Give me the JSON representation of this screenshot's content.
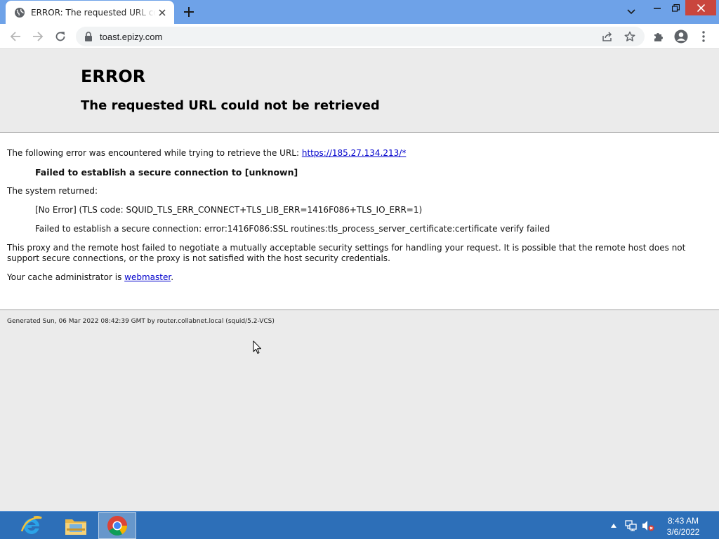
{
  "browser": {
    "tab": {
      "title": "ERROR: The requested URL could not be retrieved",
      "icon": "globe-icon"
    },
    "new_tab_symbol": "+",
    "address": {
      "url": "toast.epizy.com",
      "icon": "lock-icon"
    }
  },
  "page": {
    "heading": "ERROR",
    "subheading": "The requested URL could not be retrieved",
    "intro_text": "The following error was encountered while trying to retrieve the URL: ",
    "intro_link": "https://185.27.134.213/*",
    "error_title": "Failed to establish a secure connection to [unknown]",
    "system_returned": "The system returned:",
    "detail_line_1": "[No Error] (TLS code: SQUID_TLS_ERR_CONNECT+TLS_LIB_ERR=1416F086+TLS_IO_ERR=1)",
    "detail_line_2": "Failed to establish a secure connection: error:1416F086:SSL routines:tls_process_server_certificate:certificate verify failed",
    "explanation": "This proxy and the remote host failed to negotiate a mutually acceptable security settings for handling your request. It is possible that the remote host does not support secure connections, or the proxy is not satisfied with the host security credentials.",
    "admin_text": "Your cache administrator is ",
    "admin_link": "webmaster",
    "admin_suffix": ".",
    "footer": "Generated Sun, 06 Mar 2022 08:42:39 GMT by router.collabnet.local (squid/5.2-VCS)"
  },
  "taskbar": {
    "apps": [
      "internet-explorer-icon",
      "file-explorer-icon",
      "chrome-icon"
    ],
    "clock_time": "8:43 AM",
    "clock_date": "3/6/2022"
  },
  "colors": {
    "tabstrip": "#6ea2e8",
    "taskbar": "#2d6fb8",
    "link": "#0000cc",
    "window_close": "#c9463d"
  }
}
